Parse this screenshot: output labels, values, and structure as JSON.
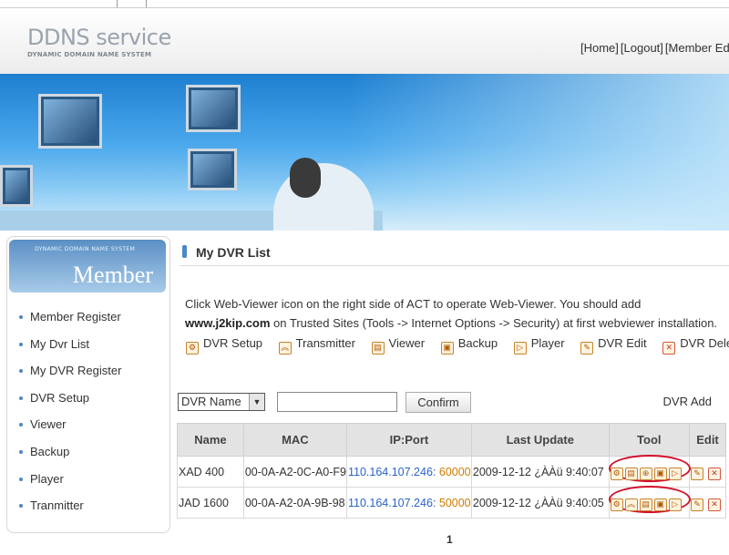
{
  "header": {
    "logo_title": "DDNS service",
    "logo_subtitle": "DYNAMIC DOMAIN NAME SYSTEM",
    "nav": [
      "[Home]",
      "[Logout]",
      "[Member Edit]"
    ]
  },
  "sidebar": {
    "box_subtitle": "DYNAMIC DOMAIN NAME SYSTEM",
    "box_title": "Member",
    "items": [
      "Member Register",
      "My Dvr List",
      "My DVR Register",
      "DVR Setup",
      "Viewer",
      "Backup",
      "Player",
      "Tranmitter"
    ]
  },
  "content": {
    "title": "My DVR List",
    "instruction_1": "Click Web-Viewer icon on the right side of ACT to operate Web-Viewer. You should add ",
    "instruction_link": "www.j2kip.com",
    "instruction_2": " on Trusted Sites (Tools -> Internet Options -> Security) at first webviewer installation.",
    "legend": [
      "DVR Setup",
      "Transmitter",
      "Viewer",
      "Backup",
      "Player",
      "DVR Edit",
      "DVR Delete"
    ]
  },
  "search": {
    "select_value": "DVR Name",
    "input_value": "",
    "confirm_label": "Confirm",
    "add_label": "DVR Add"
  },
  "table": {
    "headers": [
      "Name",
      "MAC",
      "IP:Port",
      "Last Update",
      "Tool",
      "Edit"
    ],
    "rows": [
      {
        "name": "XAD 400",
        "mac": "00-0A-A2-0C-A0-F9",
        "ip": "110.164.107.246",
        "sep": ":",
        "port": " 60000",
        "last_update": "2009-12-12 ¿ÀÀü 9:40:07"
      },
      {
        "name": "JAD 1600",
        "mac": "00-0A-A2-0A-9B-98",
        "ip": "110.164.107.246",
        "sep": ":",
        "port": " 50000",
        "last_update": "2009-12-12 ¿ÀÀü 9:40:05"
      }
    ]
  },
  "pagination": {
    "current": "1"
  },
  "colors": {
    "accent": "#4b88c4",
    "highlight_oval": "#d2102a",
    "ip_blue": "#2a63c8",
    "port_orange": "#d07b00"
  }
}
